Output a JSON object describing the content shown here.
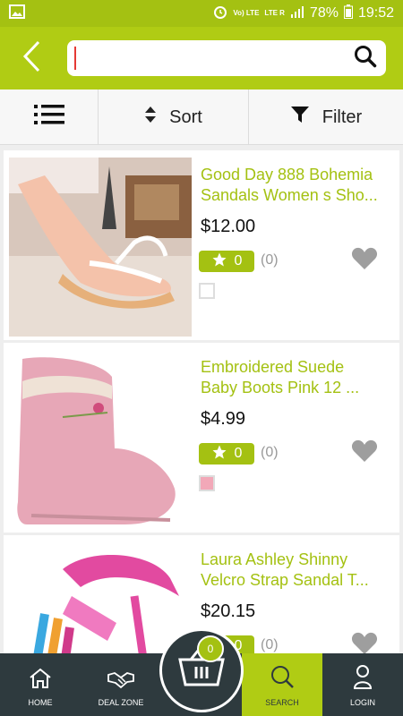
{
  "status_bar": {
    "network": "Vo) LTE",
    "lte2": "LTE R",
    "battery": "78%",
    "time": "19:52"
  },
  "search": {
    "value": "",
    "placeholder": ""
  },
  "toolbar": {
    "sort_label": "Sort",
    "filter_label": "Filter"
  },
  "products": [
    {
      "title1": "Good Day 888 Bohemia",
      "title2": "Sandals Women s Sho...",
      "price": "$12.00",
      "rating": "0",
      "reviews": "(0)"
    },
    {
      "title1": "Embroidered Suede",
      "title2": "Baby Boots  Pink  12 ...",
      "price": "$4.99",
      "rating": "0",
      "reviews": "(0)"
    },
    {
      "title1": "Laura Ashley Shinny",
      "title2": "Velcro Strap Sandal  T...",
      "price": "$20.15",
      "rating": "0",
      "reviews": "(0)"
    }
  ],
  "nav": {
    "home": "HOME",
    "deal_zone": "DEAL ZONE",
    "cart_count": "0",
    "search": "SEARCH",
    "login": "LOGIN"
  },
  "colors": {
    "brand": "#b0cc14",
    "nav_bg": "#2e3a3e"
  }
}
